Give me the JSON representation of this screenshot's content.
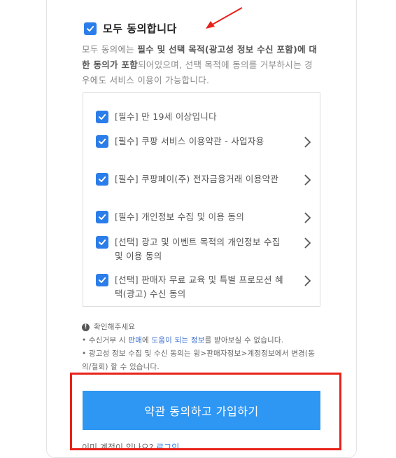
{
  "agree_all": {
    "label": "모두 동의합니다",
    "checked": true
  },
  "description": {
    "part1": "모두 동의에는 ",
    "highlight1": "필수 및 선택 목적(광고성 정보 수신 포함)에 대한 동의가 포함",
    "part2": "되어있으며, 선택 목적에 동의를 거부하시는 경우에도 서비스 이용이 가능합니다."
  },
  "terms": [
    {
      "label": "[필수] 만 19세 이상입니다",
      "checked": true,
      "has_detail": false
    },
    {
      "label": "[필수] 쿠팡 서비스 이용약관 - 사업자용",
      "checked": true,
      "has_detail": true
    },
    {
      "label": "[필수] 쿠팡페이(주) 전자금융거래 이용약관",
      "checked": true,
      "has_detail": true
    },
    {
      "label": "[필수] 개인정보 수집 및 이용 동의",
      "checked": true,
      "has_detail": true
    },
    {
      "label": "[선택] 광고 및 이벤트 목적의 개인정보 수집 및 이용 동의",
      "checked": true,
      "has_detail": true
    },
    {
      "label": "[선택] 판매자 무료 교육 및 특별 프로모션 혜택(광고) 수신 동의",
      "checked": true,
      "has_detail": true
    }
  ],
  "notice": {
    "title": "확인해주세요",
    "line1_pre": "• 수신거부 시 ",
    "line1_hl1": "판매",
    "line1_mid1": "에 ",
    "line1_hl2": "도움이 되는 정보",
    "line1_post": "를 받아보실 수 없습니다.",
    "line2": "• 광고성 정보 수집 및 수신 동의는 윙>판매자정보>계정정보에서 변경(동의/철회) 할 수 있습니다."
  },
  "submit_button": "약관 동의하고 가입하기",
  "login_prompt": {
    "text": "이미 계정이 있나요? ",
    "link": "로그인"
  },
  "colors": {
    "checkbox": "#2b7de9",
    "button": "#2e96f3",
    "highlight_box": "#e8221a",
    "annotation_arrow": "#e8221a"
  }
}
